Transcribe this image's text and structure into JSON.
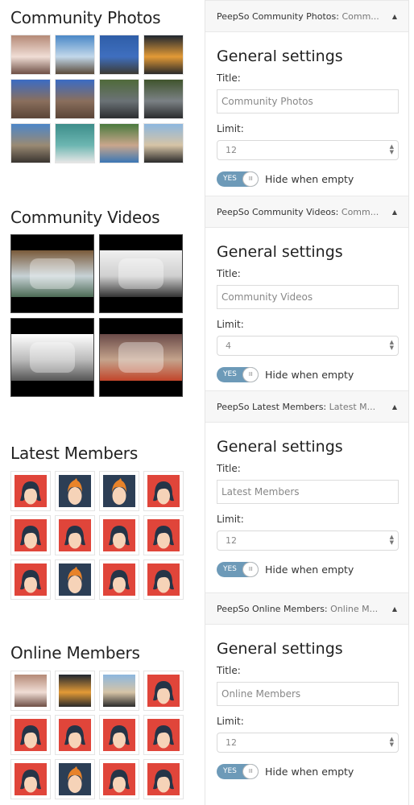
{
  "previews": {
    "photos": {
      "title": "Community Photos",
      "items": [
        {
          "subject": "woman-lying-portrait",
          "colors": [
            "#b58a77",
            "#f0ddd5",
            "#6e4f45"
          ]
        },
        {
          "subject": "motorbike-on-beach",
          "colors": [
            "#4a88c7",
            "#c2d8ea",
            "#5a4a3a"
          ]
        },
        {
          "subject": "motorbike-by-sea",
          "colors": [
            "#2f5ea8",
            "#3f6fbf",
            "#3c3a33"
          ]
        },
        {
          "subject": "silhouette-sunset",
          "colors": [
            "#1f2630",
            "#e39a36",
            "#2a2a2a"
          ]
        },
        {
          "subject": "temple-gate",
          "colors": [
            "#3b6bc4",
            "#8a6f5d",
            "#5a4437"
          ]
        },
        {
          "subject": "temple-gate",
          "colors": [
            "#3b6bc4",
            "#8a6f5d",
            "#5a4437"
          ]
        },
        {
          "subject": "road-ride",
          "colors": [
            "#4f6a3a",
            "#6b7276",
            "#2c2e30"
          ]
        },
        {
          "subject": "road-ride-curve",
          "colors": [
            "#40542d",
            "#7b8185",
            "#2b2c2e"
          ]
        },
        {
          "subject": "motorbike-beach",
          "colors": [
            "#4d86c8",
            "#9a8a73",
            "#3a3530"
          ]
        },
        {
          "subject": "snorkeling",
          "colors": [
            "#3d8d8a",
            "#6cb6b1",
            "#e6e6e6"
          ]
        },
        {
          "subject": "selfie-pool",
          "colors": [
            "#4a7a3e",
            "#c9a68c",
            "#3b77b5"
          ]
        },
        {
          "subject": "rider-beach",
          "colors": [
            "#8db7df",
            "#d6c4a6",
            "#2b2b2b"
          ]
        }
      ]
    },
    "videos": {
      "title": "Community Videos",
      "items": [
        {
          "subject": "castaway-wilson",
          "colors": [
            "#7a5a3a",
            "#c7d2d6",
            "#4c6a55"
          ]
        },
        {
          "subject": "screen-recording",
          "colors": [
            "#f0f0f0",
            "#d0d0d0",
            "#333333"
          ]
        },
        {
          "subject": "gospel-sketch",
          "colors": [
            "#ffffff",
            "#bbbbbb",
            "#555555"
          ]
        },
        {
          "subject": "jimmy-kimmel-live",
          "colors": [
            "#6a4a48",
            "#c4a38c",
            "#c2452a"
          ]
        }
      ]
    },
    "latest_members": {
      "title": "Latest Members",
      "items": [
        "female",
        "male",
        "male",
        "female",
        "female",
        "female",
        "female",
        "female",
        "female",
        "male",
        "female",
        "female"
      ]
    },
    "online_members": {
      "title": "Online Members",
      "items": [
        "photo:woman-lying-portrait",
        "photo:silhouette-sunset",
        "photo:rider-beach",
        "female",
        "female",
        "female",
        "female",
        "female",
        "female",
        "male",
        "female",
        "female"
      ]
    }
  },
  "avatar_colors": {
    "female_bg": "#e0453a",
    "male_bg": "#2c3e55",
    "hair_dark": "#253447",
    "hair_orange": "#e8832a",
    "skin": "#f6d3b8"
  },
  "panels": [
    {
      "header_prefix": "PeepSo Community Photos:",
      "header_suffix": " Comm...",
      "section_title": "General settings",
      "title_label": "Title:",
      "title_value": "Community Photos",
      "limit_label": "Limit:",
      "limit_value": "12",
      "toggle_text": "YES",
      "toggle_on": true,
      "toggle_label": "Hide when empty"
    },
    {
      "header_prefix": "PeepSo Community Videos:",
      "header_suffix": " Comm...",
      "section_title": "General settings",
      "title_label": "Title:",
      "title_value": "Community Videos",
      "limit_label": "Limit:",
      "limit_value": "4",
      "toggle_text": "YES",
      "toggle_on": true,
      "toggle_label": "Hide when empty"
    },
    {
      "header_prefix": "PeepSo Latest Members:",
      "header_suffix": " Latest M...",
      "section_title": "General settings",
      "title_label": "Title:",
      "title_value": "Latest Members",
      "limit_label": "Limit:",
      "limit_value": "12",
      "toggle_text": "YES",
      "toggle_on": true,
      "toggle_label": "Hide when empty"
    },
    {
      "header_prefix": "PeepSo Online Members:",
      "header_suffix": " Online M...",
      "section_title": "General settings",
      "title_label": "Title:",
      "title_value": "Online Members",
      "limit_label": "Limit:",
      "limit_value": "12",
      "toggle_text": "YES",
      "toggle_on": true,
      "toggle_label": "Hide when empty"
    }
  ],
  "icons": {
    "collapse": "▲",
    "spinner_up": "▲",
    "spinner_down": "▼",
    "toggle_grip": "III"
  }
}
